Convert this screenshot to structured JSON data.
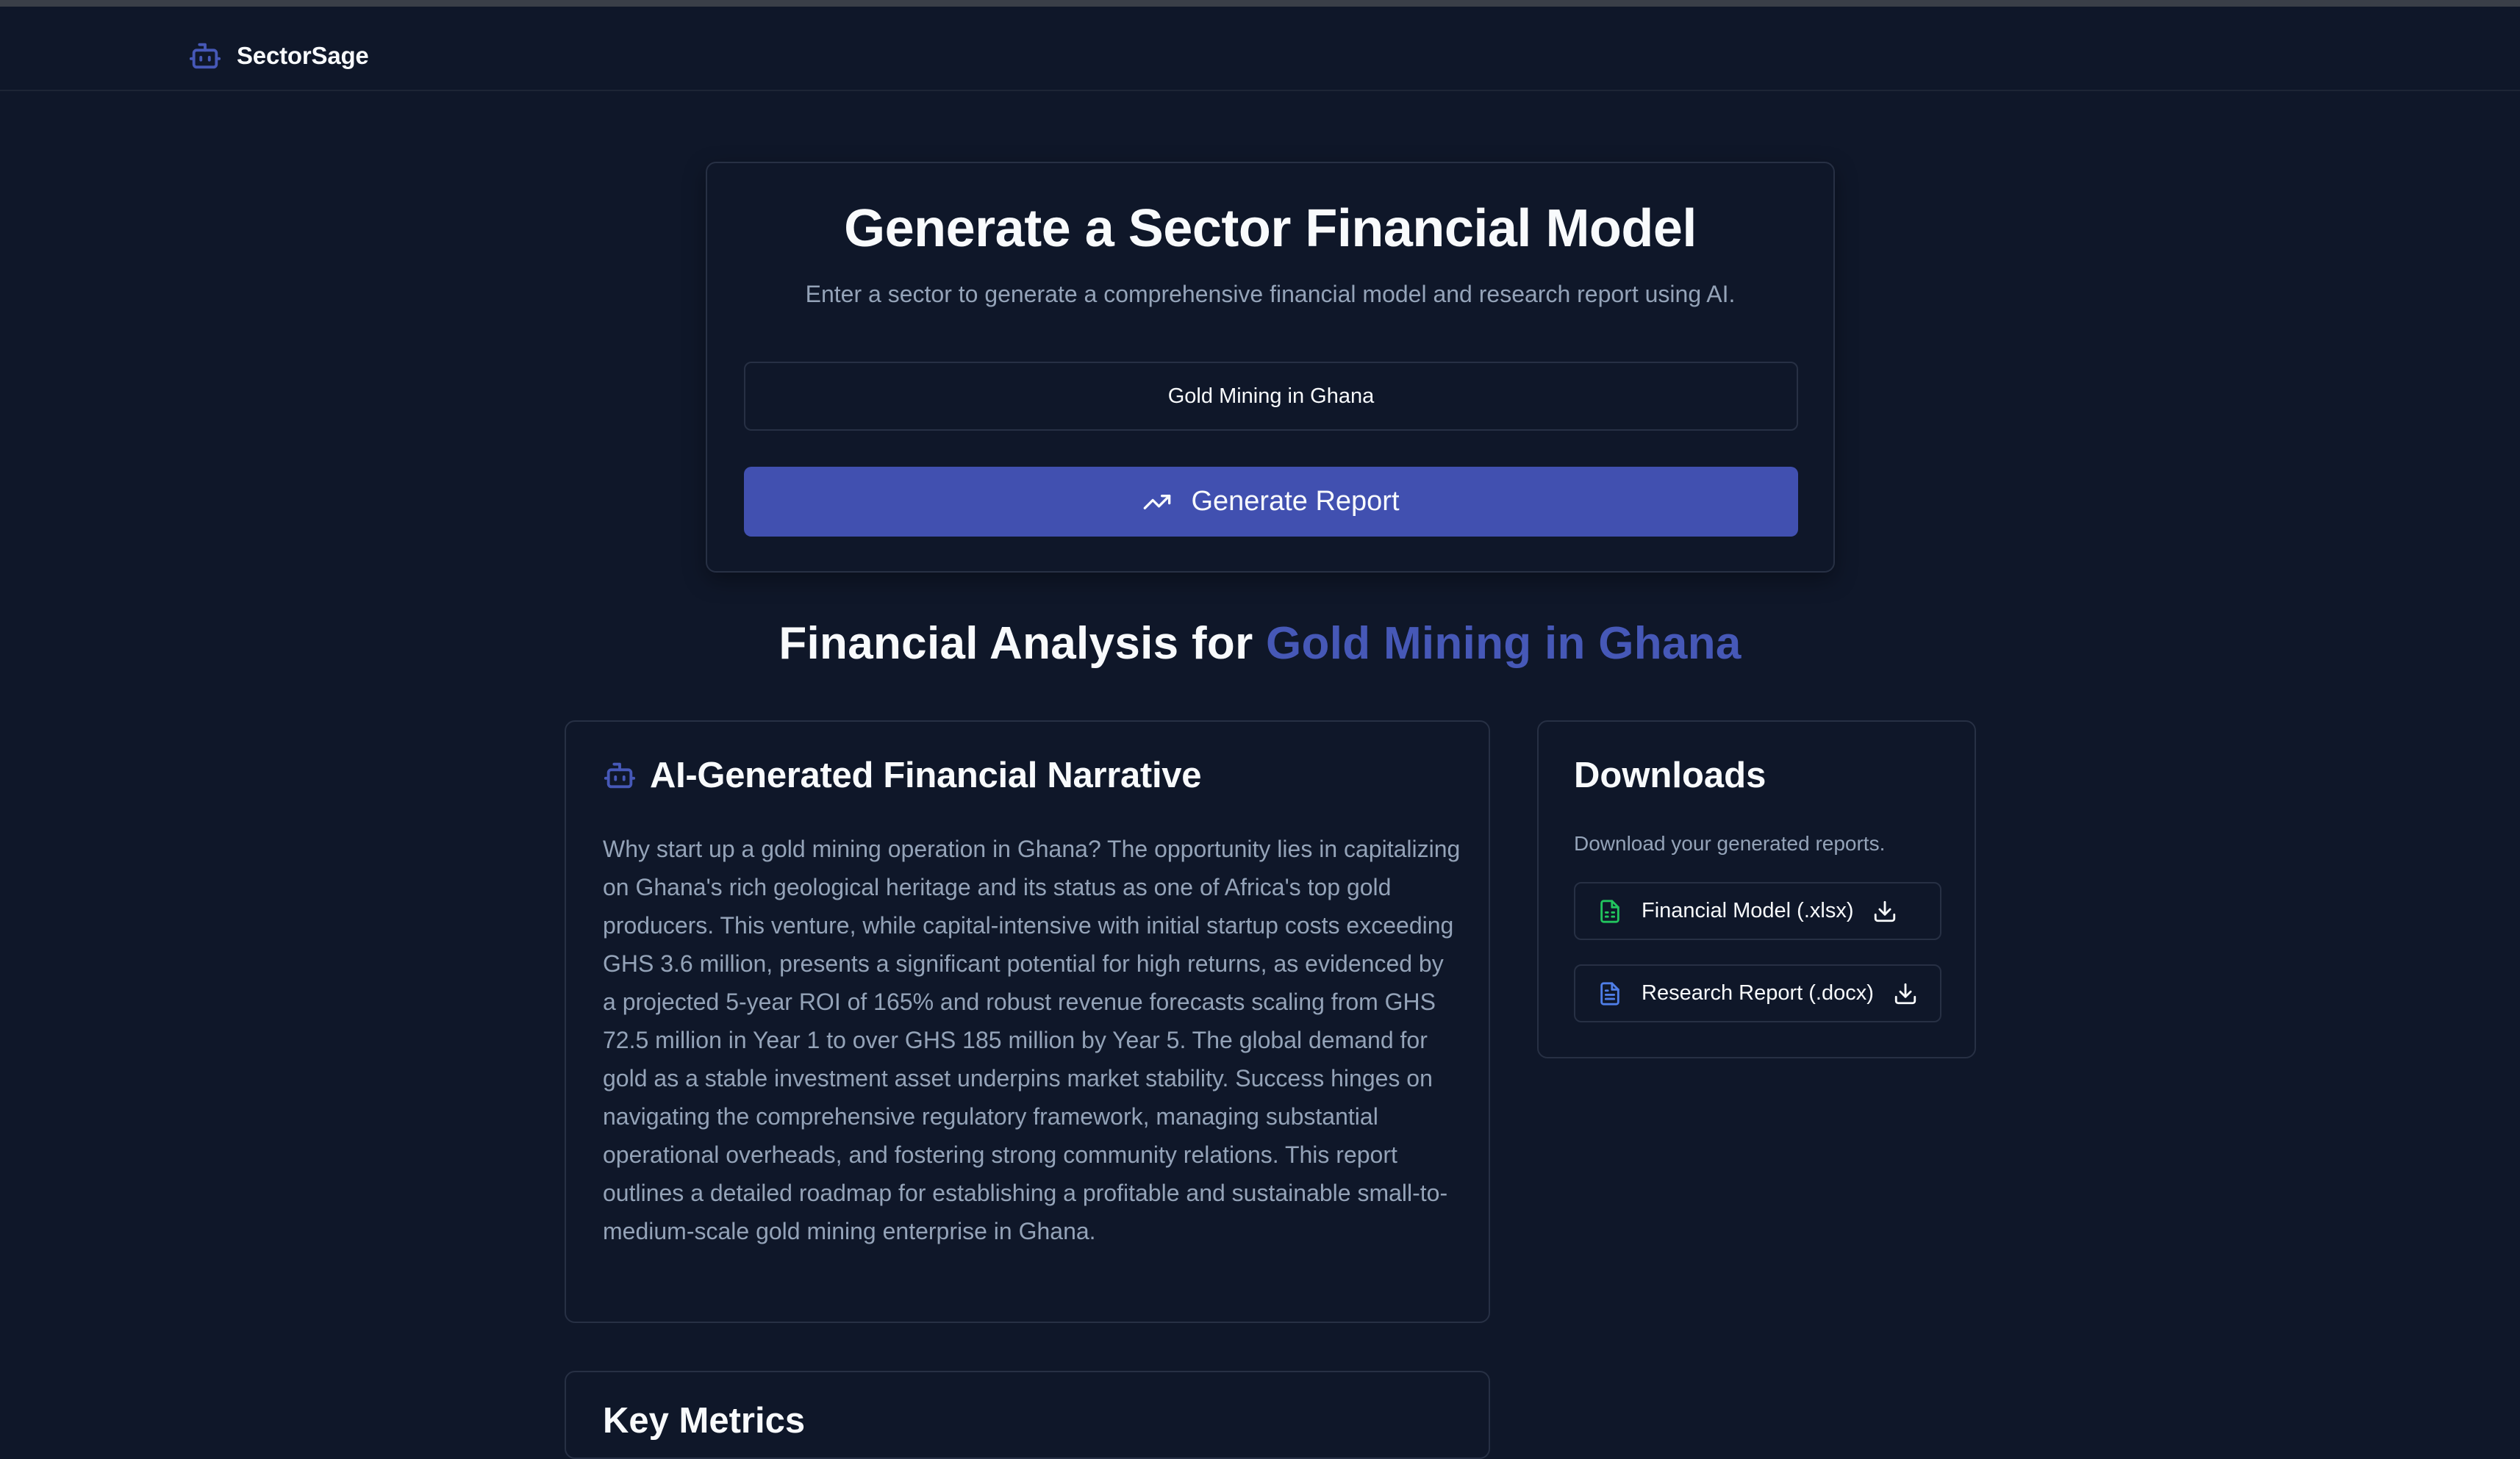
{
  "nav": {
    "brand_icon": "robot-icon",
    "brand_name": "SectorSage"
  },
  "generator": {
    "title": "Generate a Sector Financial Model",
    "subtitle": "Enter a sector to generate a comprehensive financial model and research report using AI.",
    "input_value": "Gold Mining in Ghana",
    "button_icon": "trending-up-icon",
    "button_label": "Generate Report"
  },
  "analysis": {
    "heading_prefix": "Financial Analysis for ",
    "heading_sector": "Gold Mining in Ghana"
  },
  "narrative": {
    "icon": "robot-icon",
    "title": "AI-Generated Financial Narrative",
    "body": "Why start up a gold mining operation in Ghana? The opportunity lies in capitalizing on Ghana's rich geological heritage and its status as one of Africa's top gold producers. This venture, while capital-intensive with initial startup costs exceeding GHS 3.6 million, presents a significant potential for high returns, as evidenced by a projected 5-year ROI of 165% and robust revenue forecasts scaling from GHS 72.5 million in Year 1 to over GHS 185 million by Year 5. The global demand for gold as a stable investment asset underpins market stability. Success hinges on navigating the comprehensive regulatory framework, managing substantial operational overheads, and fostering strong community relations. This report outlines a detailed roadmap for establishing a profitable and sustainable small-to-medium-scale gold mining enterprise in Ghana."
  },
  "downloads": {
    "title": "Downloads",
    "subtitle": "Download your generated reports.",
    "items": [
      {
        "label": "Financial Model (.xlsx)",
        "icon": "spreadsheet-file-icon"
      },
      {
        "label": "Research Report (.docx)",
        "icon": "document-file-icon"
      }
    ]
  },
  "metrics": {
    "title": "Key Metrics"
  },
  "colors": {
    "background": "#0f1729",
    "accent": "#4658b7",
    "button": "#4150b0",
    "muted_text": "#94a3b8",
    "border": "#273044",
    "xlsx_icon": "#22c55e",
    "docx_icon": "#4f7ee8"
  }
}
